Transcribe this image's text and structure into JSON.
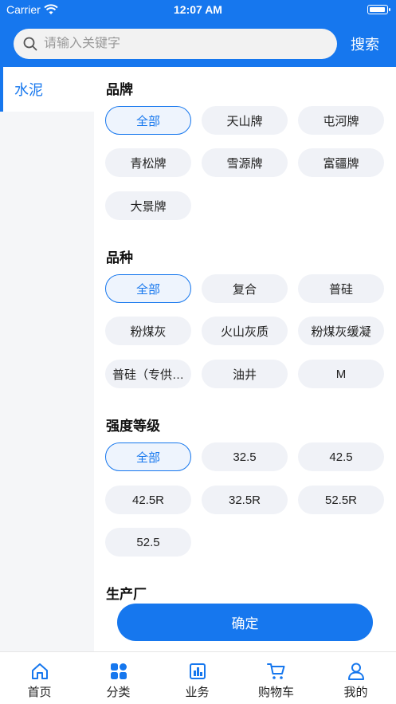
{
  "status_bar": {
    "carrier": "Carrier",
    "time": "12:07 AM"
  },
  "search": {
    "placeholder": "请输入关键字",
    "button_label": "搜索"
  },
  "sidebar": {
    "items": [
      {
        "label": "水泥",
        "selected": true
      }
    ]
  },
  "filters": {
    "brand": {
      "title": "品牌",
      "options": [
        "全部",
        "天山牌",
        "屯河牌",
        "青松牌",
        "雪源牌",
        "富疆牌",
        "大景牌"
      ],
      "selected": "全部"
    },
    "variety": {
      "title": "品种",
      "options": [
        "全部",
        "复合",
        "普硅",
        "粉煤灰",
        "火山灰质",
        "粉煤灰缓凝",
        "普硅（专供…",
        "油井",
        "M"
      ],
      "selected": "全部"
    },
    "strength": {
      "title": "强度等级",
      "options": [
        "全部",
        "32.5",
        "42.5",
        "42.5R",
        "32.5R",
        "52.5R",
        "52.5"
      ],
      "selected": "全部"
    },
    "manufacturer": {
      "title": "生产厂"
    }
  },
  "confirm_label": "确定",
  "tabbar": {
    "items": [
      {
        "label": "首页",
        "icon": "home-icon"
      },
      {
        "label": "分类",
        "icon": "category-icon",
        "active": true
      },
      {
        "label": "业务",
        "icon": "business-icon"
      },
      {
        "label": "购物车",
        "icon": "cart-icon"
      },
      {
        "label": "我的",
        "icon": "profile-icon"
      }
    ]
  },
  "colors": {
    "accent": "#1677ee",
    "chip_bg": "#f0f2f7",
    "sidebar_bg": "#f5f6f8"
  }
}
